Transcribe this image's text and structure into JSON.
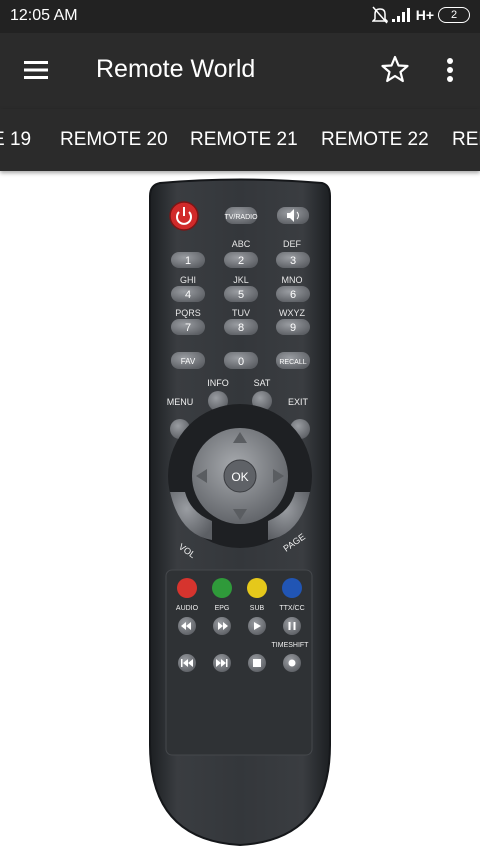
{
  "status": {
    "time": "12:05 AM",
    "network": "H+",
    "battery": "2"
  },
  "appbar": {
    "title": "Remote World"
  },
  "tabs": [
    "E 19",
    "REMOTE 20",
    "REMOTE 21",
    "REMOTE 22",
    "REM"
  ],
  "remote": {
    "top_keys": [
      "TV/RADIO"
    ],
    "letters": [
      "ABC",
      "DEF",
      "GHI",
      "JKL",
      "MNO",
      "PQRS",
      "TUV",
      "WXYZ"
    ],
    "numbers": [
      "1",
      "2",
      "3",
      "4",
      "5",
      "6",
      "7",
      "8",
      "9",
      "0"
    ],
    "fav": "FAV",
    "recall": "RECALL",
    "info": "INFO",
    "sat": "SAT",
    "menu": "MENU",
    "exit": "EXIT",
    "ok": "OK",
    "vol": "VOL",
    "page": "PAGE",
    "color_labels": [
      "AUDIO",
      "EPG",
      "SUB",
      "TTX/CC"
    ],
    "timeshift": "TIMESHIFT",
    "colors": {
      "red": "#d6342e",
      "green": "#2f9a3a",
      "yellow": "#e5c81b",
      "blue": "#2155b4"
    }
  }
}
